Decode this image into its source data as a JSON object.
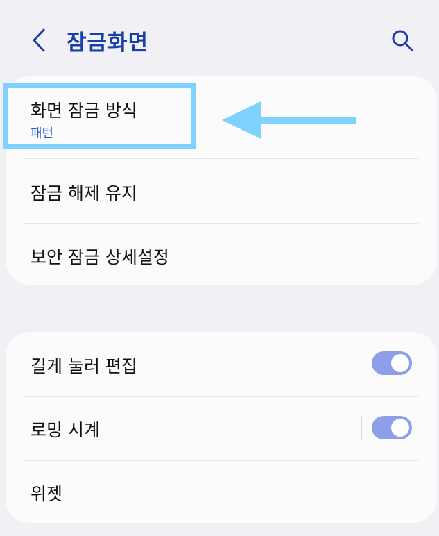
{
  "header": {
    "title": "잠금화면",
    "back_icon": "chevron-left-icon",
    "search_icon": "search-icon"
  },
  "section1": {
    "items": [
      {
        "label": "화면 잠금 방식",
        "sub": "패턴"
      },
      {
        "label": "잠금 해제 유지"
      },
      {
        "label": "보안 잠금 상세설정"
      }
    ]
  },
  "section2": {
    "items": [
      {
        "label": "길게 눌러 편집",
        "toggle": true
      },
      {
        "label": "로밍 시계",
        "toggle": true
      },
      {
        "label": "위젯"
      }
    ]
  },
  "colors": {
    "title": "#1a3fa8",
    "sub": "#2f5bd0",
    "toggle_on": "#8c9fe8",
    "highlight": "#7fd1ff"
  }
}
